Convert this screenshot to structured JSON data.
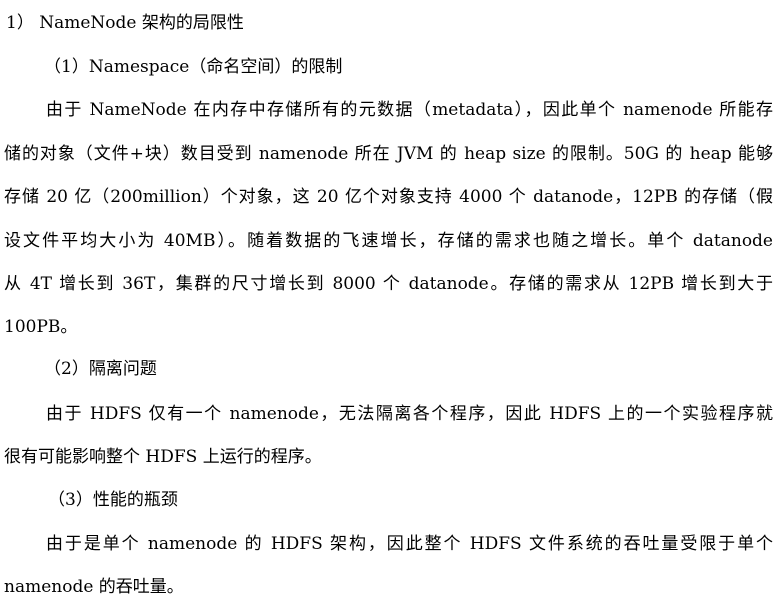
{
  "document": {
    "heading": "1） NameNode 架构的局限性",
    "sections": [
      {
        "subheading": "（1）Namespace（命名空间）的限制",
        "lines": [
          "由于 NameNode 在内存中存储所有的元数据（metadata），因此单个 namenode 所能存",
          "储的对象（文件+块）数目受到 namenode 所在 JVM 的 heap size 的限制。50G 的 heap 能够",
          "存储 20 亿（200million）个对象，这 20 亿个对象支持 4000 个 datanode，12PB 的存储（假",
          "设文件平均大小为 40MB）。随着数据的飞速增长，存储的需求也随之增长。单个 datanode",
          "从 4T 增长到 36T，集群的尺寸增长到 8000 个 datanode。存储的需求从 12PB 增长到大于",
          "100PB。"
        ]
      },
      {
        "subheading": "（2）隔离问题",
        "lines": [
          "由于 HDFS 仅有一个 namenode，无法隔离各个程序，因此 HDFS 上的一个实验程序就",
          "很有可能影响整个 HDFS 上运行的程序。"
        ]
      },
      {
        "subheading": "（3）性能的瓶颈",
        "lines": [
          "由于是单个 namenode 的 HDFS 架构，因此整个 HDFS 文件系统的吞吐量受限于单个",
          "namenode 的吞吐量。"
        ]
      }
    ]
  }
}
